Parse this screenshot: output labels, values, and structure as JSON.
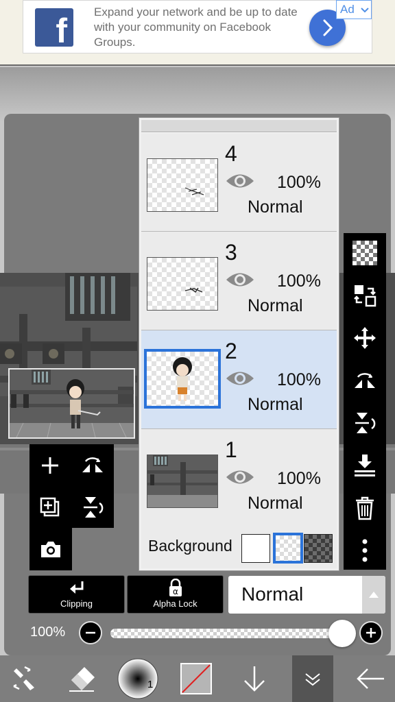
{
  "ad": {
    "text": "Expand your network and be up to date with your community on Facebook Groups.",
    "badge": "Ad",
    "logo_letter": "f",
    "brand_color": "#3b5998",
    "arrow_color": "#3f71d6"
  },
  "layers": [
    {
      "number": "4",
      "opacity": "100%",
      "blend": "Normal",
      "visible": true,
      "selected": false
    },
    {
      "number": "3",
      "opacity": "100%",
      "blend": "Normal",
      "visible": true,
      "selected": false
    },
    {
      "number": "2",
      "opacity": "100%",
      "blend": "Normal",
      "visible": true,
      "selected": true
    },
    {
      "number": "1",
      "opacity": "100%",
      "blend": "Normal",
      "visible": true,
      "selected": false
    }
  ],
  "background": {
    "label": "Background",
    "options": [
      "white",
      "transparent",
      "checker-dark"
    ],
    "selected": "transparent"
  },
  "controls": {
    "clipping_label": "Clipping",
    "alpha_lock_label": "Alpha Lock",
    "blend_mode": "Normal",
    "opacity_label": "100%",
    "opacity": 1.0
  },
  "brush": {
    "size_badge": "1"
  },
  "colors": {
    "selection_accent": "#2b73d9",
    "selected_row": "#d5e2f4",
    "toolbar": "#000000"
  }
}
